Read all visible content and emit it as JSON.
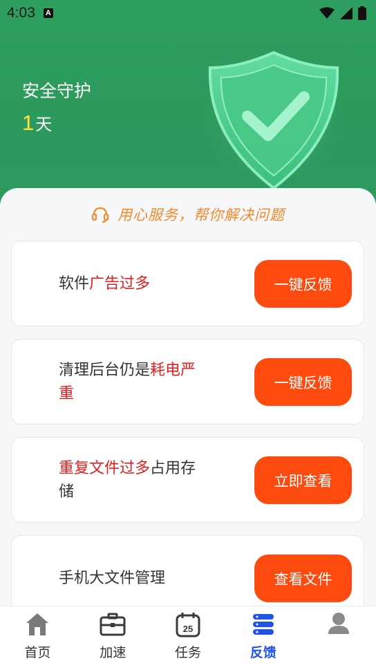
{
  "status_bar": {
    "time": "4:03",
    "notification_badge": "A"
  },
  "guard": {
    "title": "安全守护",
    "days_number": "1",
    "days_unit": "天"
  },
  "slogan": "用心服务，帮你解决问题",
  "cards": [
    {
      "text_plain_1": "软件",
      "text_highlight": "广告过多",
      "text_plain_2": "",
      "button": "一键反馈"
    },
    {
      "text_plain_1": "清理后台仍是",
      "text_highlight": "耗电严重",
      "text_plain_2": "",
      "button": "一键反馈"
    },
    {
      "text_plain_1": "",
      "text_highlight": "重复文件过多",
      "text_plain_2": "占用存储",
      "button": "立即查看"
    },
    {
      "text_plain_1": "手机大文件管理",
      "text_highlight": "",
      "text_plain_2": "",
      "button": "查看文件"
    }
  ],
  "nav": [
    {
      "label": "首页",
      "icon": "home-icon"
    },
    {
      "label": "加速",
      "icon": "briefcase-icon"
    },
    {
      "label": "任务",
      "icon": "calendar-icon",
      "calendar_day": "25"
    },
    {
      "label": "反馈",
      "icon": "server-icon",
      "active": true
    },
    {
      "label": "",
      "icon": "profile-icon"
    }
  ],
  "colors": {
    "header_green": "#2b9a5b",
    "accent_orange": "#fd4a0e",
    "highlight_red": "#e41e1e",
    "slogan_orange": "#f08a2b",
    "active_blue": "#1f54e5",
    "days_yellow": "#ffe23c"
  }
}
